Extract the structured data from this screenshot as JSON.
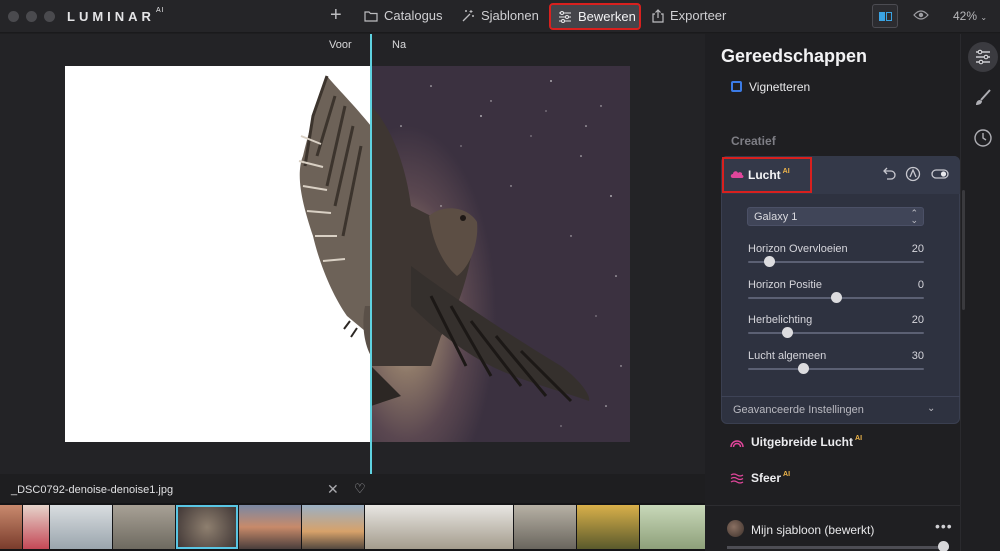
{
  "app": {
    "logo": "LUMINAR",
    "logo_sup": "AI"
  },
  "toolbar": {
    "catalogus": "Catalogus",
    "sjablonen": "Sjablonen",
    "bewerken": "Bewerken",
    "exporteer": "Exporteer",
    "zoom": "42%"
  },
  "canvas": {
    "before_label": "Voor",
    "after_label": "Na"
  },
  "file": {
    "name": "_DSC0792-denoise-denoise1.jpg"
  },
  "panel": {
    "title": "Gereedschappen",
    "vignetteren": "Vignetteren",
    "section_creatief": "Creatief",
    "lucht": {
      "label": "Lucht",
      "ai": "AI",
      "preset": "Galaxy 1",
      "sliders": [
        {
          "label": "Horizon Overvloeien",
          "value": "20",
          "fraction": 0.12
        },
        {
          "label": "Horizon Positie",
          "value": "0",
          "fraction": 0.5
        },
        {
          "label": "Herbelichting",
          "value": "20",
          "fraction": 0.22
        },
        {
          "label": "Lucht algemeen",
          "value": "30",
          "fraction": 0.31
        }
      ],
      "advanced": "Geavanceerde Instellingen"
    },
    "tools": [
      {
        "label": "Uitgebreide Lucht",
        "ai": "AI"
      },
      {
        "label": "Sfeer",
        "ai": "AI"
      }
    ],
    "footer": {
      "label": "Mijn sjabloon (bewerkt)",
      "dots": "•••"
    }
  },
  "colors": {
    "accent": "#3aa3e3",
    "highlight": "#d8201e",
    "split": "#5fd2e0",
    "ai": "#f0b64a",
    "tool_pink": "#e0469b"
  }
}
